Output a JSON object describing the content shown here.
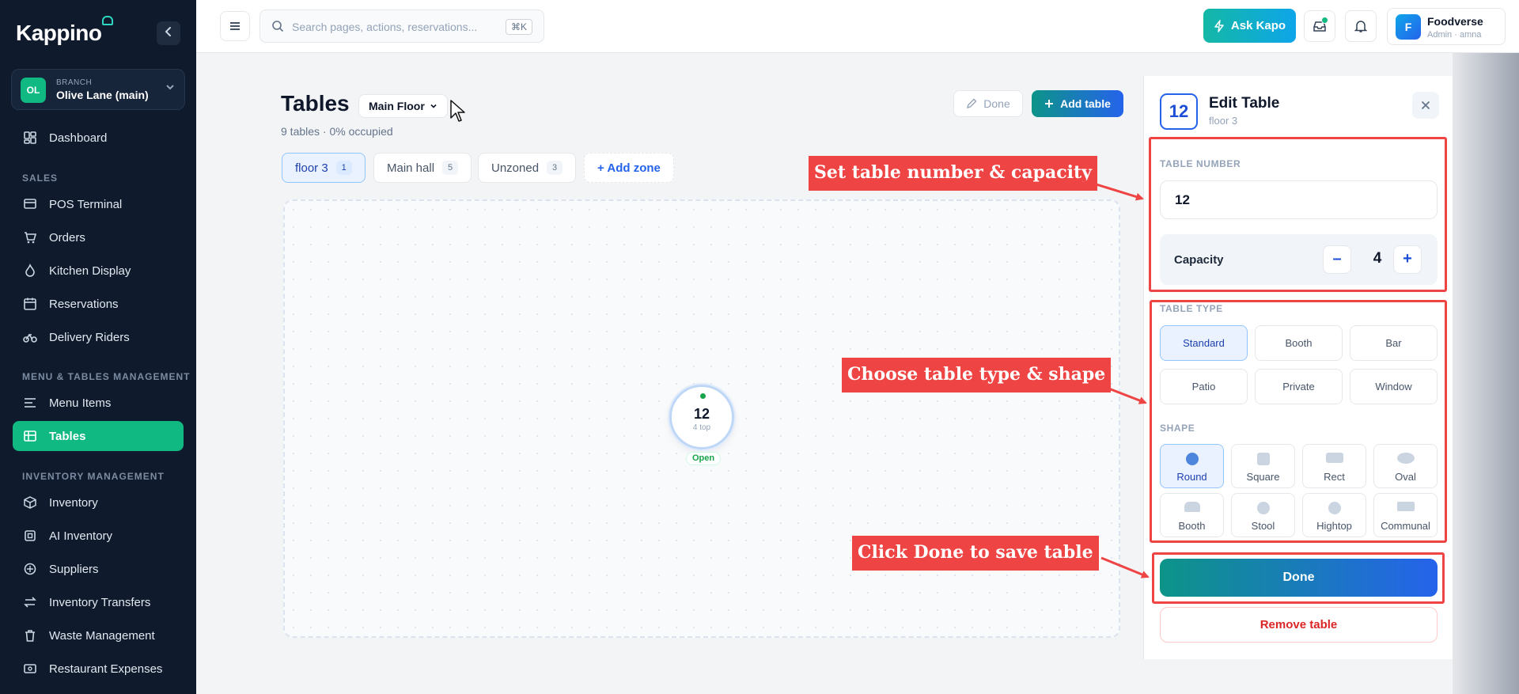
{
  "app": {
    "name": "Kappino",
    "collapse_icon": "chevron-left-icon"
  },
  "branch": {
    "initials": "OL",
    "label": "BRANCH",
    "name": "Olive Lane (main)"
  },
  "sidebar": {
    "items": [
      {
        "label": "Dashboard",
        "icon": "dashboard-icon"
      },
      {
        "label": "POS Terminal",
        "icon": "terminal-icon"
      },
      {
        "label": "Orders",
        "icon": "cart-icon"
      },
      {
        "label": "Kitchen Display",
        "icon": "flame-icon"
      },
      {
        "label": "Reservations",
        "icon": "calendar-icon"
      },
      {
        "label": "Delivery Riders",
        "icon": "bike-icon"
      },
      {
        "label": "Menu Items",
        "icon": "list-icon"
      },
      {
        "label": "Tables",
        "icon": "grid-icon"
      },
      {
        "label": "Inventory",
        "icon": "box-icon"
      },
      {
        "label": "AI Inventory",
        "icon": "ai-icon"
      },
      {
        "label": "Suppliers",
        "icon": "supplier-icon"
      },
      {
        "label": "Inventory Transfers",
        "icon": "transfer-icon"
      },
      {
        "label": "Waste Management",
        "icon": "trash-icon"
      },
      {
        "label": "Restaurant Expenses",
        "icon": "wallet-icon"
      }
    ],
    "sections": {
      "sales": "SALES",
      "menu_tables": "MENU & TABLES MANAGEMENT",
      "inventory": "INVENTORY MANAGEMENT"
    },
    "active_item": "Tables"
  },
  "topbar": {
    "search_placeholder": "Search pages, actions, reservations...",
    "search_shortcut": "⌘K",
    "ask_label": "Ask Kapo",
    "user": {
      "initial": "F",
      "name": "Foodverse",
      "role": "Admin · amna"
    }
  },
  "main": {
    "title": "Tables",
    "floor_select": "Main Floor",
    "subtitle": "9 tables · 0% occupied",
    "done_label": "Done",
    "add_table_label": "Add table",
    "zones": [
      {
        "label": "floor 3",
        "count": "1",
        "active": true
      },
      {
        "label": "Main hall",
        "count": "5",
        "active": false
      },
      {
        "label": "Unzoned",
        "count": "3",
        "active": false
      }
    ],
    "add_zone_label": "+ Add zone",
    "table": {
      "number": "12",
      "capacity_label": "4 top",
      "status": "Open",
      "status_color": "#16a34a"
    }
  },
  "panel": {
    "number": "12",
    "title": "Edit Table",
    "zone": "floor 3",
    "table_number_label": "TABLE NUMBER",
    "table_number_value": "12",
    "capacity_label": "Capacity",
    "capacity_value": "4",
    "minus": "–",
    "plus": "+",
    "table_type_label": "TABLE TYPE",
    "table_types": [
      "Standard",
      "Booth",
      "Bar",
      "Patio",
      "Private",
      "Window"
    ],
    "selected_type": "Standard",
    "shape_label": "SHAPE",
    "shapes": [
      "Round",
      "Square",
      "Rect",
      "Oval",
      "Booth",
      "Stool",
      "Hightop",
      "Communal"
    ],
    "selected_shape": "Round",
    "done_label": "Done",
    "remove_label": "Remove table"
  },
  "annotations": {
    "callout_1": "Set table number & capacity",
    "callout_2": "Choose table type & shape",
    "callout_3": "Click Done to save table",
    "color": "#ef4444"
  }
}
